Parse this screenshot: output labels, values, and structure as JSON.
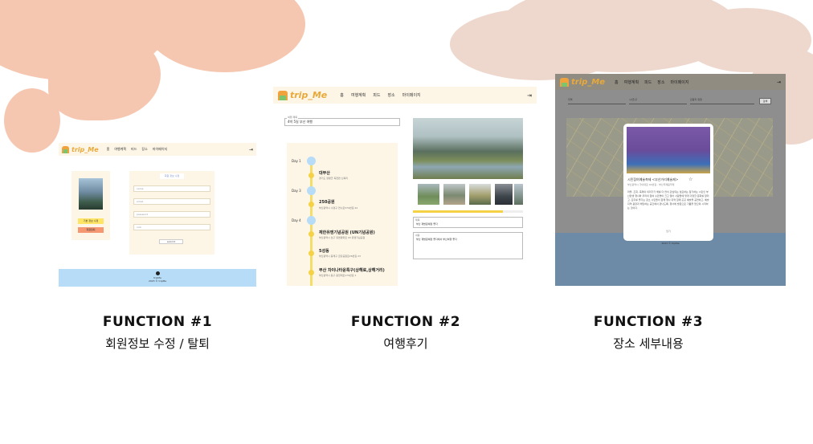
{
  "colors": {
    "blob_left": "#f6c7b0",
    "blob_right": "#eed8cd",
    "header_bg": "#fdf6e7",
    "footer_blue": "#b7dcf7",
    "accent_yellow": "#f5d245",
    "logo_orange": "#e9a93a"
  },
  "app": {
    "logo_text": "trip_Me",
    "nav": [
      "홈",
      "여행계획",
      "피드",
      "장소",
      "마이페이지"
    ],
    "logout_icon": "logout-icon"
  },
  "panel1": {
    "btn_edit": "기본 정보 수정",
    "btn_withdraw": "회원탈퇴",
    "form_title": "회원 정보 수정",
    "fields": [
      "name",
      "email",
      "password",
      "nick"
    ],
    "submit": "submit",
    "footer_line1": "tripMe",
    "footer_line2": "2023 © tripMe"
  },
  "panel2": {
    "title_label": "여행 제목",
    "title_value": "4박 5일 부산 여행",
    "days": [
      "Day 1",
      "Day 3",
      "Day 4"
    ],
    "places": [
      {
        "name": "대부산",
        "addr": "경기도 양평군 옥천면 신복리"
      },
      {
        "name": "250공원",
        "addr": "부산광역시 수영구 연수로379번길 42"
      },
      {
        "name": "재한유엔기념공원 (UN기념공원)",
        "addr": "부산광역시 남구 유엔평화로 93 유엔기념공원"
      },
      {
        "name": "5성동",
        "addr": "부산광역시 동래구 금강공원로26번길 23"
      },
      {
        "name": "부산 차이나타운특구(상해로,상해거리)",
        "addr": "부산광역시 동구 중앙대로179번길 1"
      }
    ],
    "progress_fraction": 0.82,
    "review1_label": "제목",
    "review1_value": "부산 재방문예정 좋다",
    "review2_label": "내용",
    "review2_value": "부산 재방문예정 좋다에서 부산여행 좋다"
  },
  "panel3": {
    "filters": [
      "지역",
      "시/군/구",
      "관광지 유형"
    ],
    "search": "검색",
    "modal_title": "시민참여예술축제 <부산거리예술제>",
    "modal_addr": "부산광역시 가야대로 00번길 - 부산국제음악제",
    "modal_desc": "마을, 조회, 축제의 의미가가 해를 더 많이 관심되는 필요하는 참가하는 시민인 부산만생 행사와 우리의 참여 수만명이 크고 열어 사람들에 맞게 다양한 문화를 알리고, 모두를 즐기는 장소 시민들이 함께 행사 지역 함께 곳곳 예술을 공연하고, 예술 지역 광장과 해당하는 공간에서 만나도록, 행사에 방문으로 기쁨을 얻으며 시작하는 것이다.",
    "modal_close": "닫기",
    "footer_line1": "tripMe",
    "footer_line2": "2023 © tripMe"
  },
  "functions": [
    {
      "title": "FUNCTION #1",
      "subtitle": "회원정보 수정 / 탈퇴"
    },
    {
      "title": "FUNCTION  #2",
      "subtitle": "여행후기"
    },
    {
      "title": "FUNCTION #3",
      "subtitle": "장소 세부내용"
    }
  ]
}
